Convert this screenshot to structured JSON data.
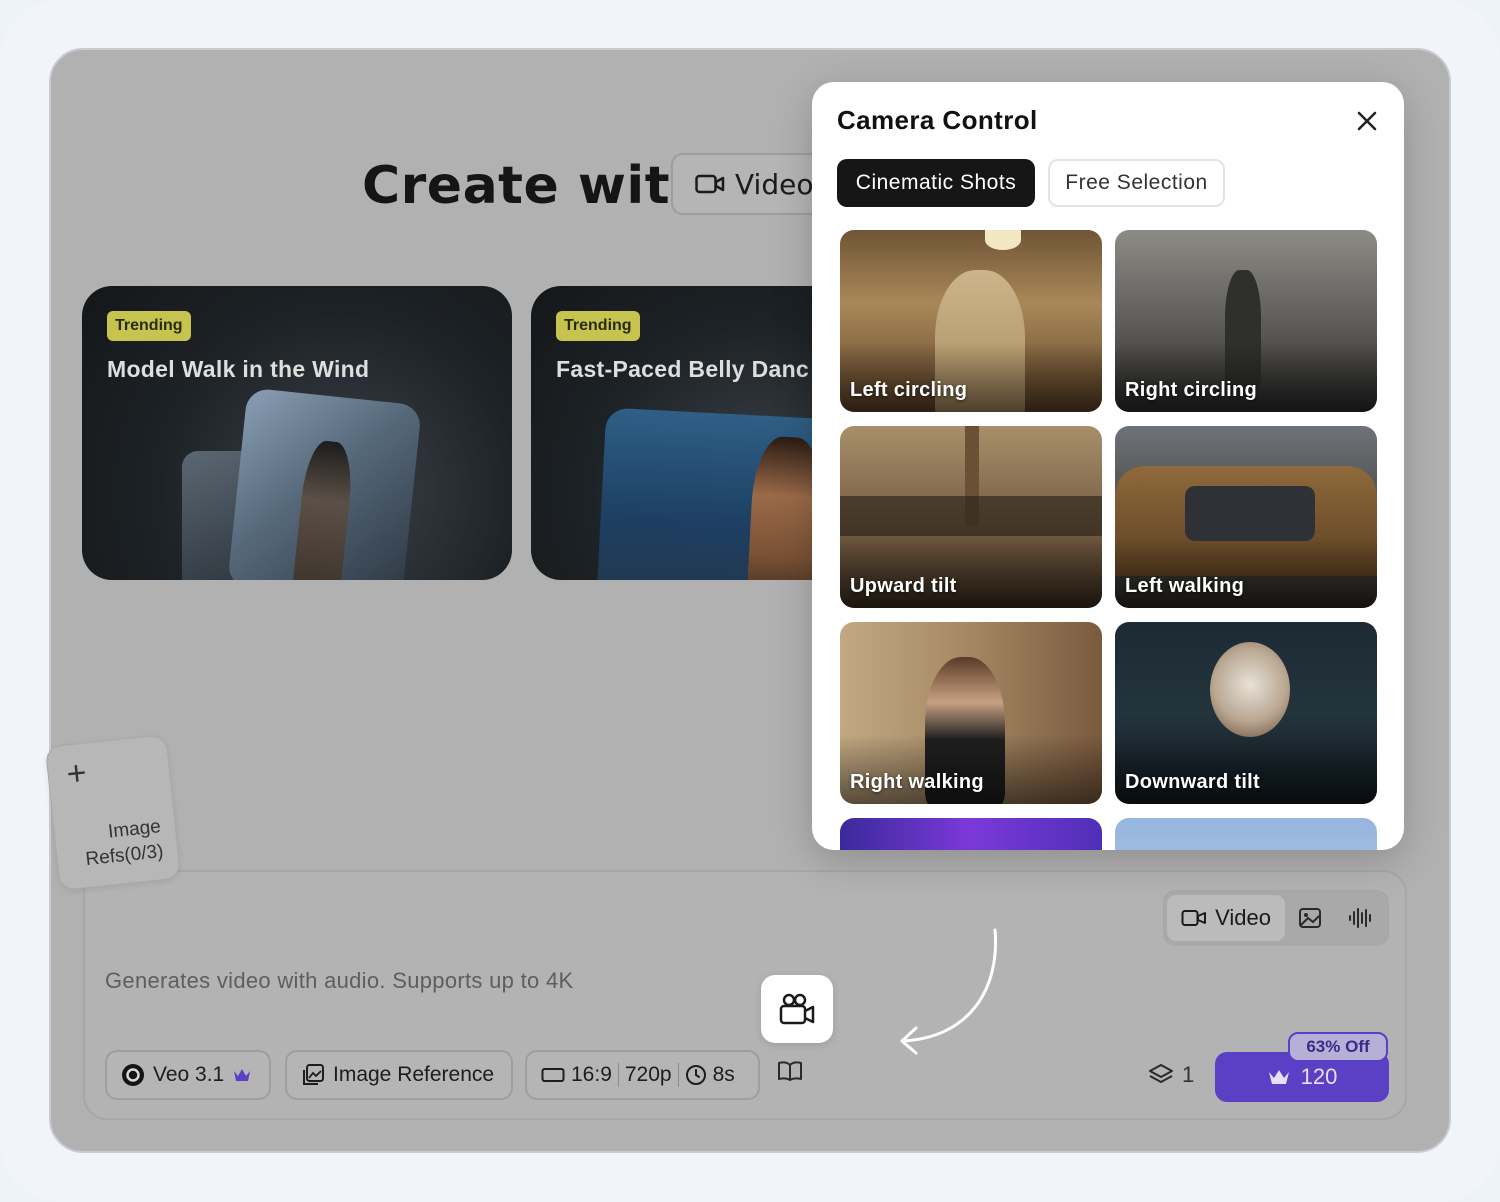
{
  "hero": {
    "title": "Create with",
    "mode_label": "Video"
  },
  "trending_cards": [
    {
      "badge": "Trending",
      "title": "Model Walk in the Wind"
    },
    {
      "badge": "Trending",
      "title": "Fast-Paced Belly Danc"
    }
  ],
  "image_refs": {
    "plus": "+",
    "label": "Image Refs(0/3)"
  },
  "prompt": {
    "placeholder": "Generates video with audio. Supports up to 4K"
  },
  "media_toggle": {
    "video_label": "Video",
    "icons": [
      "video-icon",
      "image-icon",
      "audio-wave-icon"
    ]
  },
  "toolbar": {
    "model_label": "Veo 3.1",
    "image_reference_label": "Image Reference",
    "aspect_ratio": "16:9",
    "resolution": "720p",
    "duration": "8s",
    "layers_count": "1",
    "credits": "120",
    "discount": "63% Off"
  },
  "camera_control": {
    "title": "Camera Control",
    "tabs": [
      "Cinematic Shots",
      "Free Selection"
    ],
    "active_tab": "Cinematic Shots",
    "shots": [
      "Left circling",
      "Right circling",
      "Upward tilt",
      "Left walking",
      "Right walking",
      "Downward tilt",
      "",
      ""
    ]
  },
  "colors": {
    "accent": "#5b3fc4",
    "badge": "#c7c34f",
    "active_tab": "#161616"
  }
}
